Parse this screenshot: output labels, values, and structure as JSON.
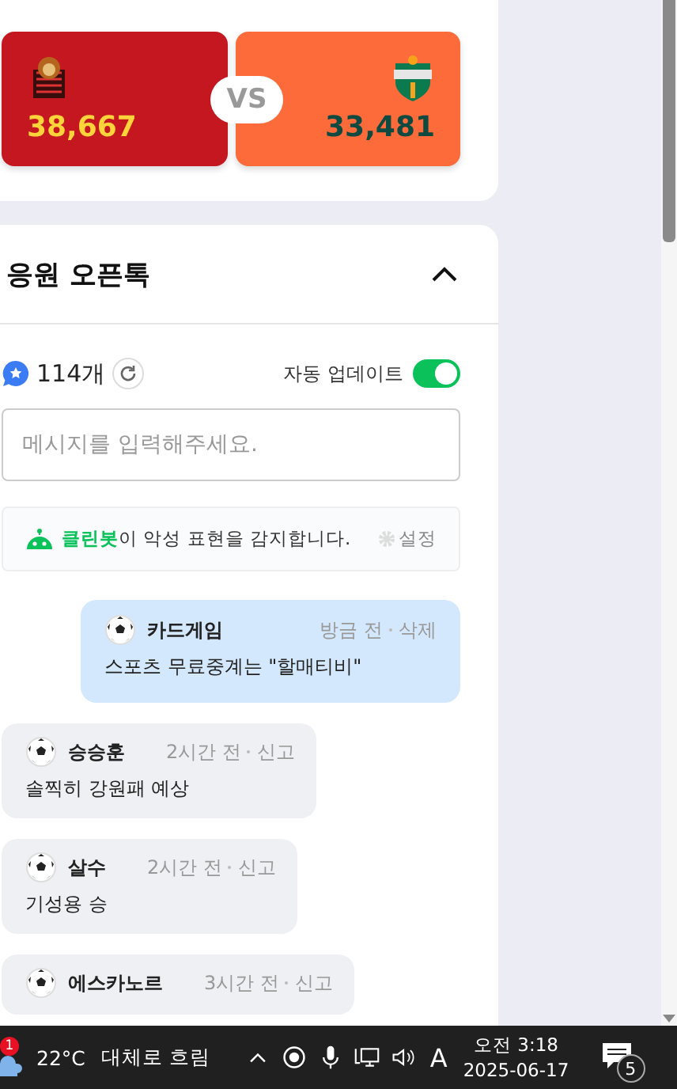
{
  "match": {
    "home": {
      "count": "38,667"
    },
    "vs": "VS",
    "away": {
      "count": "33,481"
    }
  },
  "chat": {
    "title": "응원 오픈톡",
    "expanded": true,
    "count": "114개",
    "auto_update": {
      "label": "자동 업데이트",
      "on": true
    },
    "input": {
      "placeholder": "메시지를 입력해주세요."
    },
    "cleanbot": {
      "text": "**클린봇**이 악성 표현을 감지합니다.",
      "settings": "설정"
    },
    "messages": [
      {
        "kind": "mine",
        "name": "카드게임",
        "time": "방금 전",
        "action": "삭제",
        "text": "스포츠 무료중계는 \"할매티비\""
      },
      {
        "kind": "other",
        "name": "승승훈",
        "time": "2시간 전",
        "action": "신고",
        "text": "솔찍히 강원패 예상"
      },
      {
        "kind": "other",
        "name": "살수",
        "time": "2시간 전",
        "action": "신고",
        "text": "기성용 승"
      },
      {
        "kind": "other",
        "name": "에스카노르",
        "time": "3시간 전",
        "action": "신고"
      }
    ]
  },
  "taskbar": {
    "weather_badge": "1",
    "temperature": "22°C",
    "weather": "대체로 흐림",
    "ime": "A",
    "time": "오전 3:18",
    "date": "2025-06-17",
    "notifications": "5"
  }
}
